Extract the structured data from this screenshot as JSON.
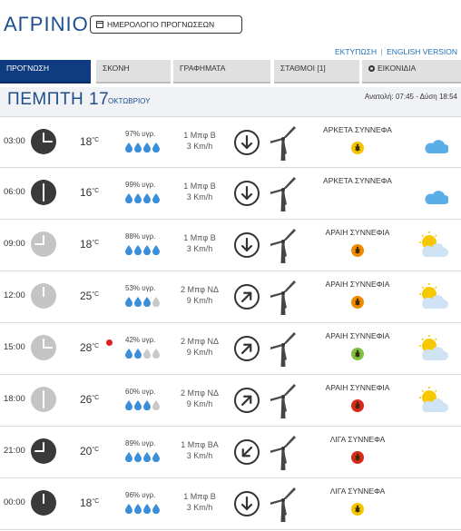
{
  "header": {
    "city": "ΑΓΡΙΝΙΟ",
    "calendar_button": "ΗΜΕΡΟΛΟΓΙΟ ΠΡΟΓΝΩΣΕΩΝ",
    "print_link": "ΕΚΤΥΠΩΣΗ",
    "separator": "|",
    "english_link": "ENGLISH VERSION"
  },
  "tabs": [
    {
      "label": "ΠΡΟΓΝΩΣΗ",
      "active": true
    },
    {
      "label": "ΣΚΟΝΗ",
      "active": false
    },
    {
      "label": "ΓΡΑΦΗΜΑΤΑ",
      "active": false
    },
    {
      "label": "ΣΤΑΘΜΟΙ [1]",
      "active": false
    },
    {
      "label": "ΕΙΚΟΝΙΔΙΑ",
      "active": false,
      "icon": "gear-icon"
    }
  ],
  "day": {
    "name": "ΠΕΜΠΤΗ 17",
    "month": "ΟΚΤΩΒΡΙΟΥ",
    "sun": "Ανατολή: 07:45 - Δύση 18:54"
  },
  "colors": {
    "brand_blue": "#1e4f8c",
    "active_tab": "#0f3b80",
    "drop_full": "#3b8fd9",
    "drop_empty": "#c9c9c9",
    "risk_yellow": "#f5c400",
    "risk_orange": "#f08a00",
    "risk_green": "#7dc242",
    "risk_red": "#d9291c"
  },
  "forecast": [
    {
      "time": "03:00",
      "clock": "dark",
      "hour": 3,
      "temp": "18",
      "unit": "°C",
      "hot": false,
      "humidity": "97% υγρ.",
      "drops": 4,
      "wind_force": "1 Μπφ Β",
      "wind_speed": "3 Km/h",
      "wind_dir": "down",
      "condition": "ΑΡΚΕΤΑ ΣΥΝΝΕΦΑ",
      "risk": "yellow",
      "weather_icon": "moon-cloud-icon"
    },
    {
      "time": "06:00",
      "clock": "dark",
      "hour": 6,
      "temp": "16",
      "unit": "°C",
      "hot": false,
      "humidity": "99% υγρ.",
      "drops": 4,
      "wind_force": "1 Μπφ Β",
      "wind_speed": "3 Km/h",
      "wind_dir": "down",
      "condition": "ΑΡΚΕΤΑ ΣΥΝΝΕΦΑ",
      "risk": "none",
      "weather_icon": "moon-cloud-icon"
    },
    {
      "time": "09:00",
      "clock": "light",
      "hour": 9,
      "temp": "18",
      "unit": "°C",
      "hot": false,
      "humidity": "88% υγρ.",
      "drops": 4,
      "wind_force": "1 Μπφ Β",
      "wind_speed": "3 Km/h",
      "wind_dir": "down",
      "condition": "ΑΡΑΙΗ ΣΥΝΝΕΦΙΑ",
      "risk": "orange",
      "weather_icon": "sun-cloud-icon"
    },
    {
      "time": "12:00",
      "clock": "light",
      "hour": 12,
      "temp": "25",
      "unit": "°C",
      "hot": false,
      "humidity": "53% υγρ.",
      "drops": 3,
      "wind_force": "2 Μπφ ΝΔ",
      "wind_speed": "9 Km/h",
      "wind_dir": "up-right",
      "condition": "ΑΡΑΙΗ ΣΥΝΝΕΦΙΑ",
      "risk": "orange",
      "weather_icon": "sun-cloud-icon"
    },
    {
      "time": "15:00",
      "clock": "light",
      "hour": 15,
      "temp": "28",
      "unit": "°C",
      "hot": true,
      "humidity": "42% υγρ.",
      "drops": 2,
      "wind_force": "2 Μπφ ΝΔ",
      "wind_speed": "9 Km/h",
      "wind_dir": "up-right",
      "condition": "ΑΡΑΙΗ ΣΥΝΝΕΦΙΑ",
      "risk": "green",
      "weather_icon": "sun-cloud-icon"
    },
    {
      "time": "18:00",
      "clock": "light",
      "hour": 18,
      "temp": "26",
      "unit": "°C",
      "hot": false,
      "humidity": "60% υγρ.",
      "drops": 3,
      "wind_force": "2 Μπφ ΝΔ",
      "wind_speed": "9 Km/h",
      "wind_dir": "up-right",
      "condition": "ΑΡΑΙΗ ΣΥΝΝΕΦΙΑ",
      "risk": "red",
      "weather_icon": "sun-cloud-icon"
    },
    {
      "time": "21:00",
      "clock": "dark",
      "hour": 21,
      "temp": "20",
      "unit": "°C",
      "hot": false,
      "humidity": "89% υγρ.",
      "drops": 4,
      "wind_force": "1 Μπφ ΒΑ",
      "wind_speed": "3 Km/h",
      "wind_dir": "down-left",
      "condition": "ΛΙΓΑ ΣΥΝΝΕΦΑ",
      "risk": "red",
      "weather_icon": "moon-star-icon"
    },
    {
      "time": "00:00",
      "clock": "dark",
      "hour": 0,
      "temp": "18",
      "unit": "°C",
      "hot": false,
      "humidity": "96% υγρ.",
      "drops": 4,
      "wind_force": "1 Μπφ Β",
      "wind_speed": "3 Km/h",
      "wind_dir": "down",
      "condition": "ΛΙΓΑ ΣΥΝΝΕΦΑ",
      "risk": "yellow",
      "weather_icon": "moon-star-icon"
    }
  ]
}
